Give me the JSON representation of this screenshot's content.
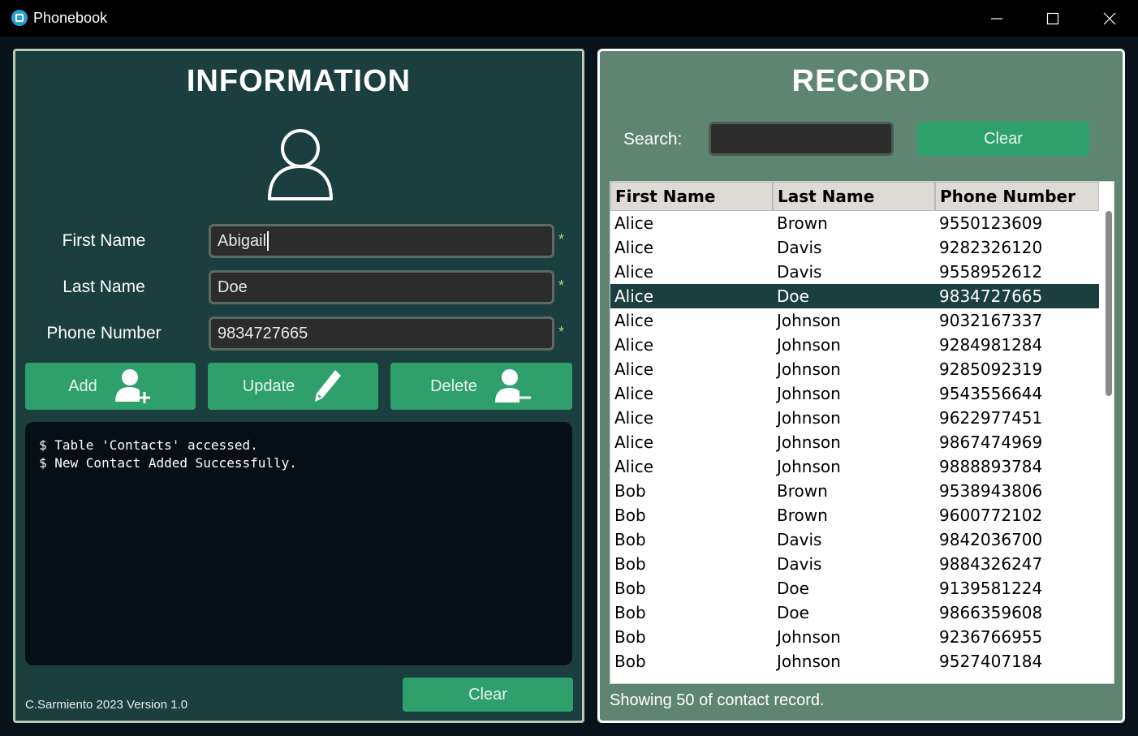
{
  "window": {
    "title": "Phonebook"
  },
  "information": {
    "title": "INFORMATION",
    "fields": {
      "first_name_label": "First Name",
      "first_name_value": "Abigail",
      "last_name_label": "Last Name",
      "last_name_value": "Doe",
      "phone_label": "Phone Number",
      "phone_value": "9834727665",
      "required_marker": "*"
    },
    "buttons": {
      "add": "Add",
      "update": "Update",
      "delete": "Delete",
      "clear": "Clear"
    },
    "console_lines": [
      "$ Table 'Contacts' accessed.",
      "$ New Contact Added Successfully."
    ],
    "footer": "C.Sarmiento 2023 Version 1.0"
  },
  "record": {
    "title": "RECORD",
    "search_label": "Search:",
    "search_value": "",
    "clear_label": "Clear",
    "columns": [
      "First Name",
      "Last Name",
      "Phone Number"
    ],
    "rows": [
      [
        "Alice",
        "Brown",
        "9550123609"
      ],
      [
        "Alice",
        "Davis",
        "9282326120"
      ],
      [
        "Alice",
        "Davis",
        "9558952612"
      ],
      [
        "Alice",
        "Doe",
        "9834727665"
      ],
      [
        "Alice",
        "Johnson",
        "9032167337"
      ],
      [
        "Alice",
        "Johnson",
        "9284981284"
      ],
      [
        "Alice",
        "Johnson",
        "9285092319"
      ],
      [
        "Alice",
        "Johnson",
        "9543556644"
      ],
      [
        "Alice",
        "Johnson",
        "9622977451"
      ],
      [
        "Alice",
        "Johnson",
        "9867474969"
      ],
      [
        "Alice",
        "Johnson",
        "9888893784"
      ],
      [
        "Bob",
        "Brown",
        "9538943806"
      ],
      [
        "Bob",
        "Brown",
        "9600772102"
      ],
      [
        "Bob",
        "Davis",
        "9842036700"
      ],
      [
        "Bob",
        "Davis",
        "9884326247"
      ],
      [
        "Bob",
        "Doe",
        "9139581224"
      ],
      [
        "Bob",
        "Doe",
        "9866359608"
      ],
      [
        "Bob",
        "Johnson",
        "9236766955"
      ],
      [
        "Bob",
        "Johnson",
        "9527407184"
      ]
    ],
    "selected_row": 3,
    "status": "Showing 50 of contact record."
  },
  "colors": {
    "left_panel": "#1b3f3e",
    "right_panel": "#5e8472",
    "button": "#2fa06c",
    "selected_row": "#1b3f3e"
  },
  "icons": {
    "app": "phonebook-app-icon",
    "avatar": "user-outline-icon",
    "add": "user-plus-icon",
    "update": "pen-icon",
    "delete": "user-minus-icon"
  }
}
